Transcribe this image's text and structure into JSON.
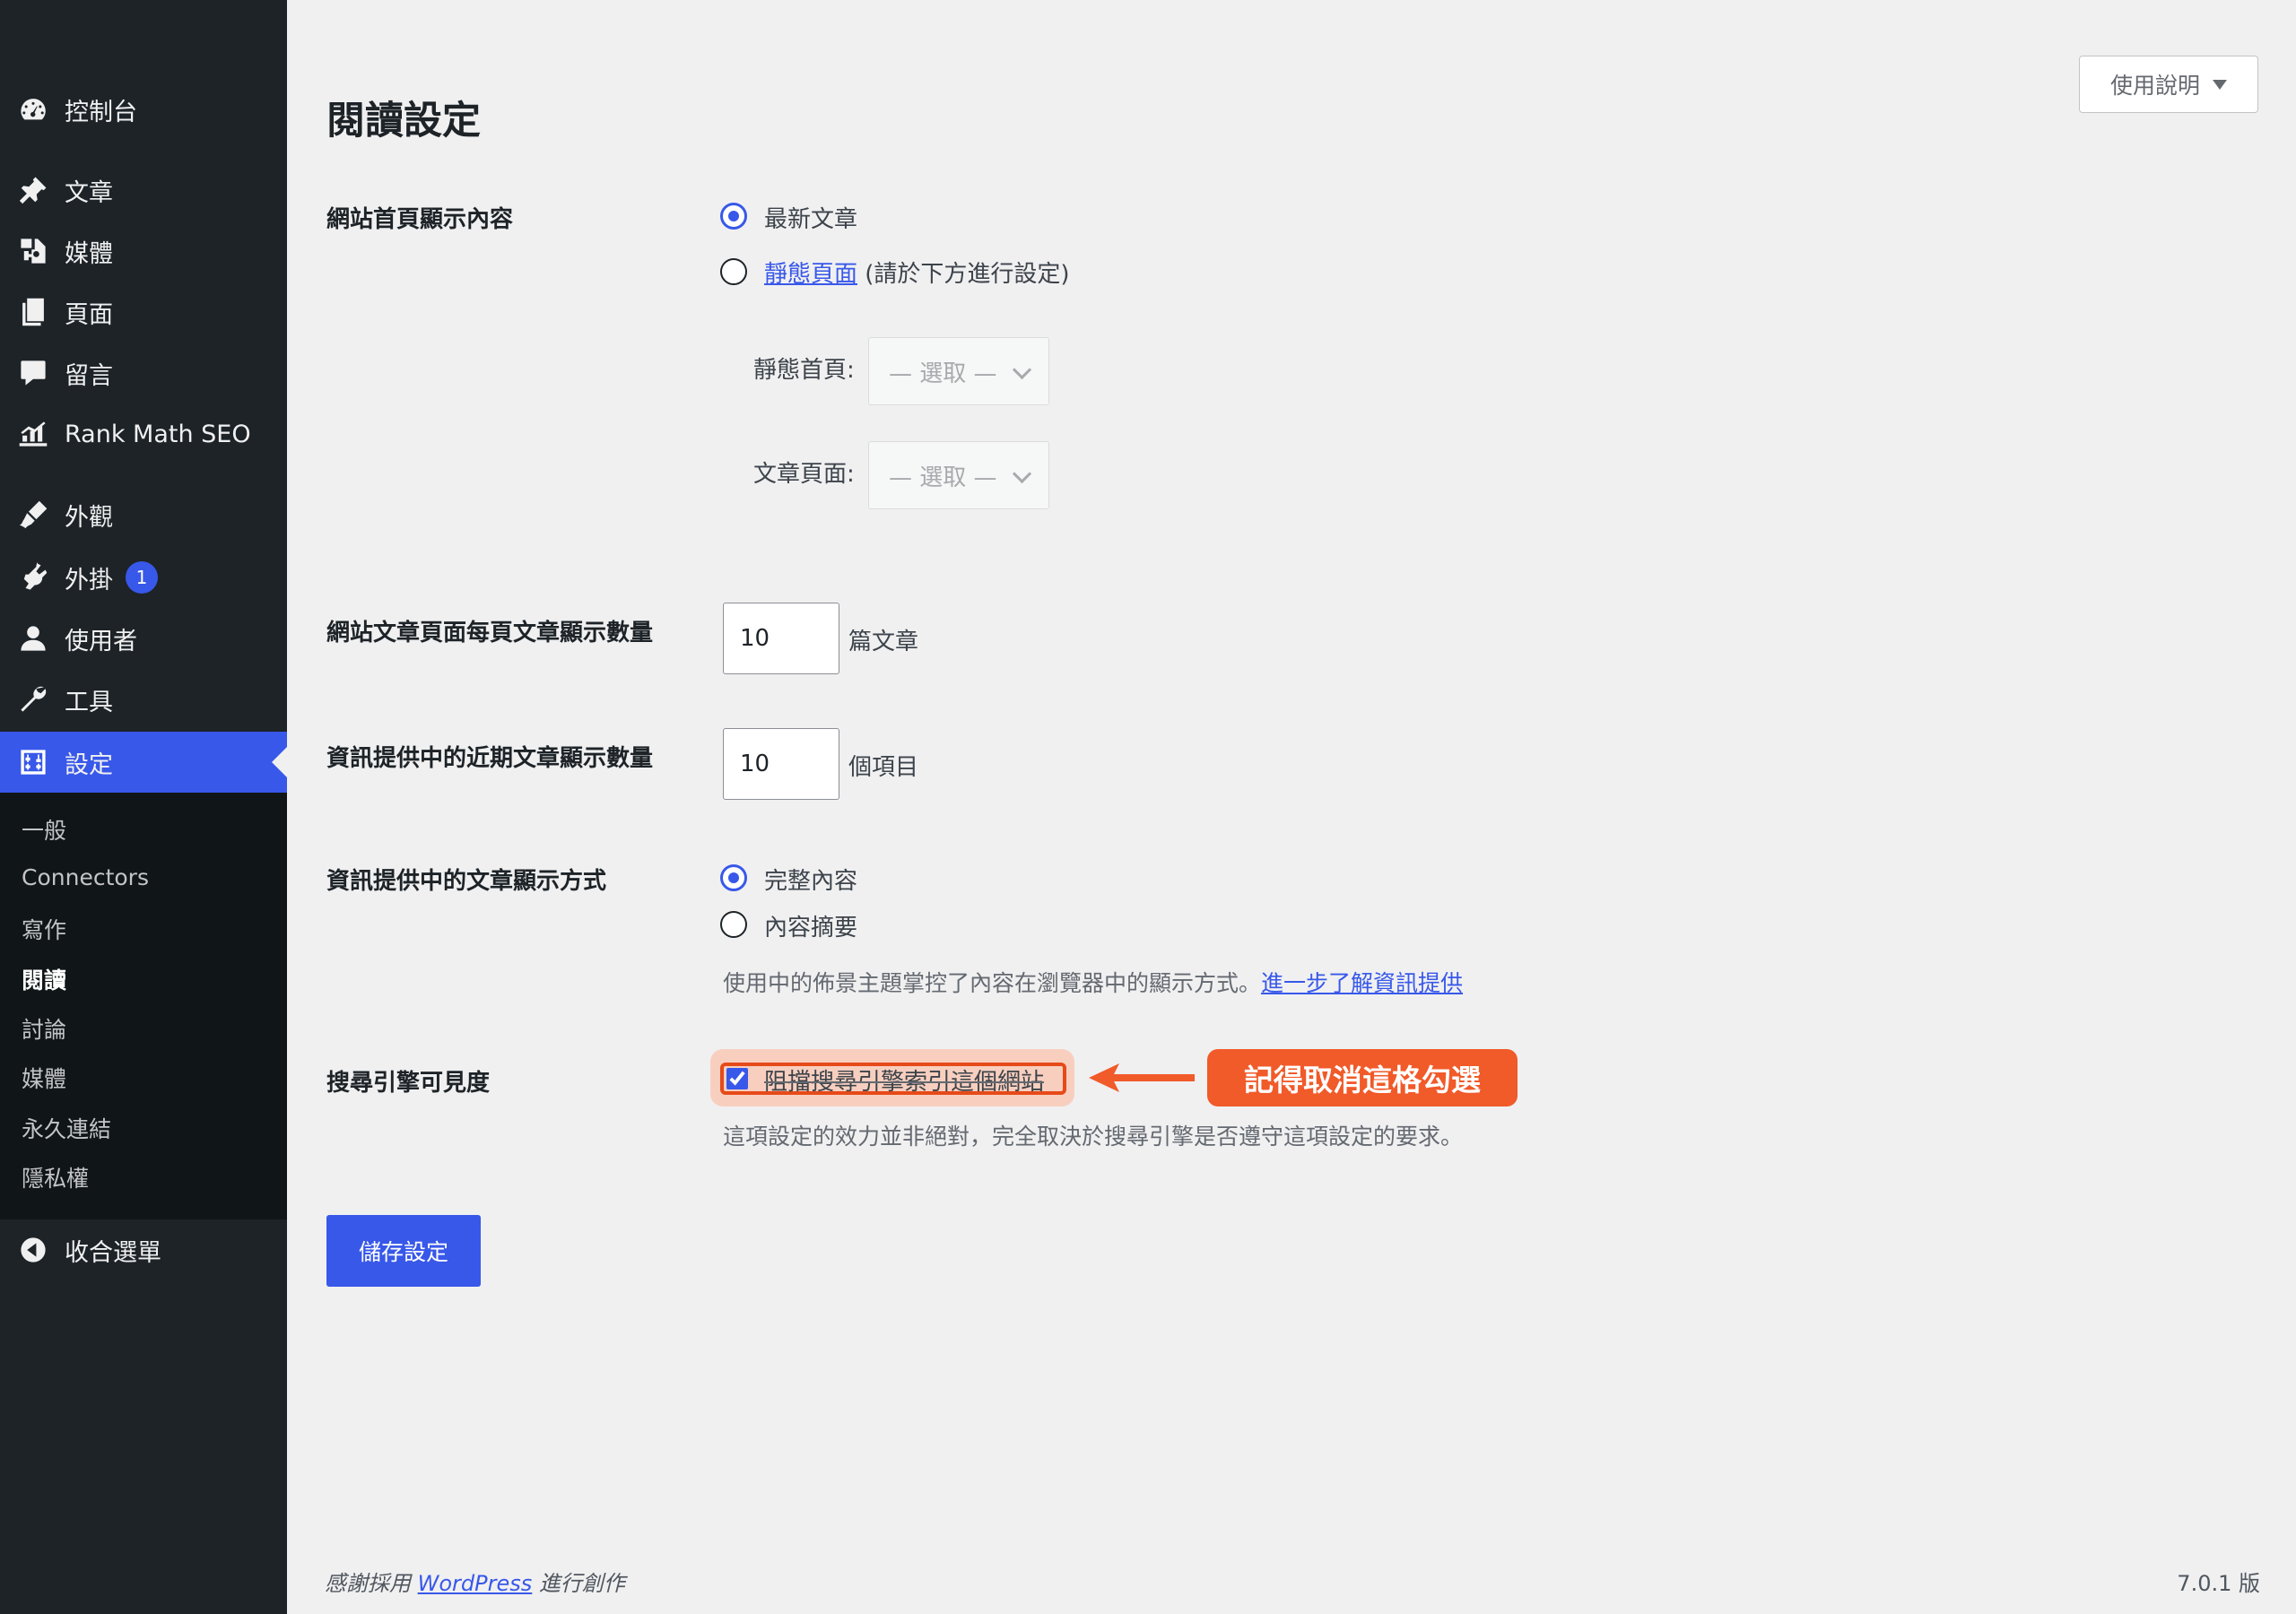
{
  "sidebar": {
    "items": [
      {
        "label": "控制台",
        "icon": "dashboard-icon"
      },
      {
        "label": "文章",
        "icon": "pin-icon"
      },
      {
        "label": "媒體",
        "icon": "media-icon"
      },
      {
        "label": "頁面",
        "icon": "pages-icon"
      },
      {
        "label": "留言",
        "icon": "comment-icon"
      },
      {
        "label": "Rank Math SEO",
        "icon": "rank-math-icon"
      },
      {
        "label": "外觀",
        "icon": "brush-icon"
      },
      {
        "label": "外掛",
        "icon": "plugin-icon",
        "badge": "1"
      },
      {
        "label": "使用者",
        "icon": "user-icon"
      },
      {
        "label": "工具",
        "icon": "wrench-icon"
      },
      {
        "label": "設定",
        "icon": "settings-icon",
        "active": true
      }
    ],
    "submenu": [
      "一般",
      "Connectors",
      "寫作",
      "閱讀",
      "討論",
      "媒體",
      "永久連結",
      "隱私權"
    ],
    "current_submenu": "閱讀",
    "collapse": "收合選單",
    "accent_color": "#3858e9"
  },
  "header": {
    "help_label": "使用說明",
    "title": "閱讀設定"
  },
  "form": {
    "homepage": {
      "label": "網站首頁顯示內容",
      "options": {
        "latest": "最新文章",
        "static_link": "靜態頁面",
        "static_suffix": "(請於下方進行設定)"
      },
      "selected": "latest",
      "static_front_label": "靜態首頁:",
      "posts_page_label": "文章頁面:",
      "select_placeholder": "— 選取 —"
    },
    "posts_per_page": {
      "label": "網站文章頁面每頁文章顯示數量",
      "value": "10",
      "unit": "篇文章"
    },
    "feed_count": {
      "label": "資訊提供中的近期文章顯示數量",
      "value": "10",
      "unit": "個項目"
    },
    "feed_display": {
      "label": "資訊提供中的文章顯示方式",
      "options": {
        "full": "完整內容",
        "excerpt": "內容摘要"
      },
      "selected": "full",
      "desc": "使用中的佈景主題掌控了內容在瀏覽器中的顯示方式。",
      "desc_link": "進一步了解資訊提供"
    },
    "visibility": {
      "label": "搜尋引擎可見度",
      "checkbox_label": "阻擋搜尋引擎索引這個網站",
      "checked": true,
      "desc": "這項設定的效力並非絕對，完全取決於搜尋引擎是否遵守這項設定的要求。",
      "annotation": "記得取消這格勾選",
      "annotation_color": "#f15a29"
    },
    "save_label": "儲存設定"
  },
  "footer": {
    "thanks_prefix": "感謝採用",
    "thanks_link": "WordPress",
    "thanks_suffix": "進行創作",
    "version": "7.0.1 版"
  }
}
